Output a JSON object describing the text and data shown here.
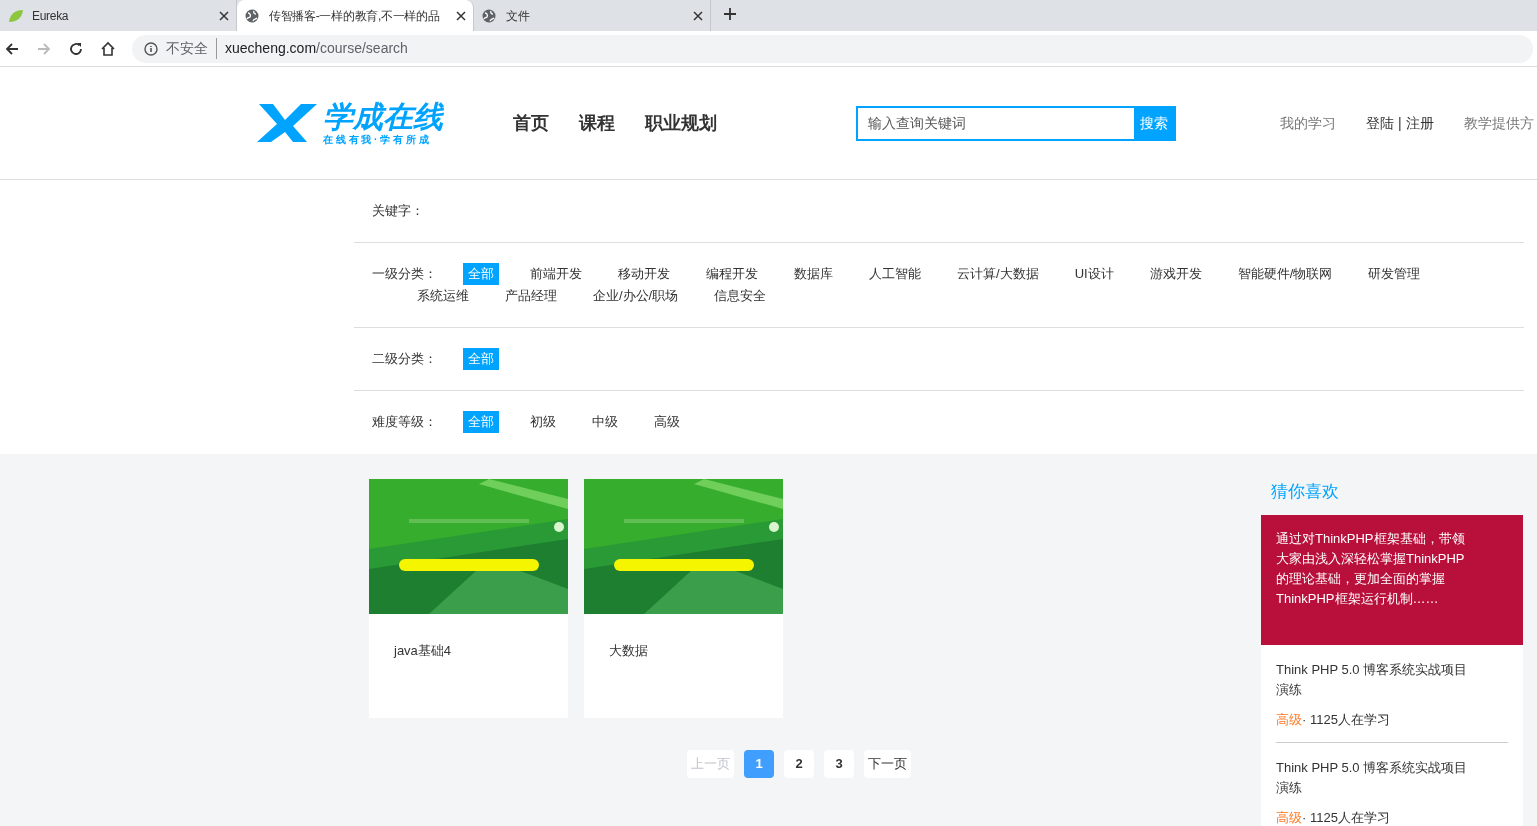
{
  "browser": {
    "tabs": [
      {
        "title": "Eureka",
        "selected": false
      },
      {
        "title": "传智播客-一样的教育,不一样的品",
        "selected": true
      },
      {
        "title": "文件",
        "selected": false
      }
    ],
    "security": "不安全",
    "url_host": "xuecheng.com",
    "url_path": "/course/search"
  },
  "header": {
    "logo_text": "学成在线",
    "logo_slogan": "在 线 有 我 · 学 有 所 成",
    "nav": [
      "首页",
      "课程",
      "职业规划"
    ],
    "search": {
      "placeholder": "输入查询关键词",
      "button": "搜索"
    },
    "my_learning": "我的学习",
    "login": "登陆",
    "separator": "|",
    "register": "注册",
    "teacher": "教学提供方"
  },
  "filters": [
    {
      "label": "关键字："
    },
    {
      "label": "一级分类：",
      "options": [
        {
          "text": "全部",
          "selected": true
        },
        {
          "text": "前端开发",
          "selected": false
        },
        {
          "text": "移动开发",
          "selected": false
        },
        {
          "text": "编程开发",
          "selected": false
        },
        {
          "text": "数据库",
          "selected": false
        },
        {
          "text": "人工智能",
          "selected": false
        },
        {
          "text": "云计算/大数据",
          "selected": false
        },
        {
          "text": "UI设计",
          "selected": false
        },
        {
          "text": "游戏开发",
          "selected": false
        },
        {
          "text": "智能硬件/物联网",
          "selected": false
        },
        {
          "text": "研发管理",
          "selected": false
        },
        {
          "text": "系统运维",
          "selected": false
        },
        {
          "text": "产品经理",
          "selected": false
        },
        {
          "text": "企业/办公/职场",
          "selected": false
        },
        {
          "text": "信息安全",
          "selected": false
        }
      ]
    },
    {
      "label": "二级分类：",
      "options": [
        {
          "text": "全部",
          "selected": true
        }
      ]
    },
    {
      "label": "难度等级：",
      "options": [
        {
          "text": "全部",
          "selected": true
        },
        {
          "text": "初级",
          "selected": false
        },
        {
          "text": "中级",
          "selected": false
        },
        {
          "text": "高级",
          "selected": false
        }
      ]
    }
  ],
  "courses": [
    {
      "kind": "picture",
      "title": "java基础4"
    },
    {
      "kind": "picture",
      "title": "大数据"
    }
  ],
  "pagination": [
    {
      "text": "上一页",
      "disabled": true,
      "selected": false
    },
    {
      "text": "1",
      "disabled": false,
      "selected": true
    },
    {
      "text": "2",
      "disabled": false,
      "selected": false
    },
    {
      "text": "3",
      "disabled": false,
      "selected": false
    },
    {
      "text": "下一页",
      "disabled": false,
      "selected": false
    }
  ],
  "recommend": {
    "title": "猜你喜欢",
    "feature": "通过对ThinkPHP框架基础，带领大家由浅入深轻松掌握ThinkPHP的理论基础，更加全面的掌握ThinkPHP框架运行机制……",
    "items": [
      {
        "title": "Think PHP 5.0 博客系统实战项目演练",
        "level": "高级",
        "learners": "· 1125人在学习"
      },
      {
        "title": "Think PHP 5.0 博客系统实战项目演练",
        "level": "高级",
        "learners": "· 1125人在学习"
      }
    ]
  }
}
